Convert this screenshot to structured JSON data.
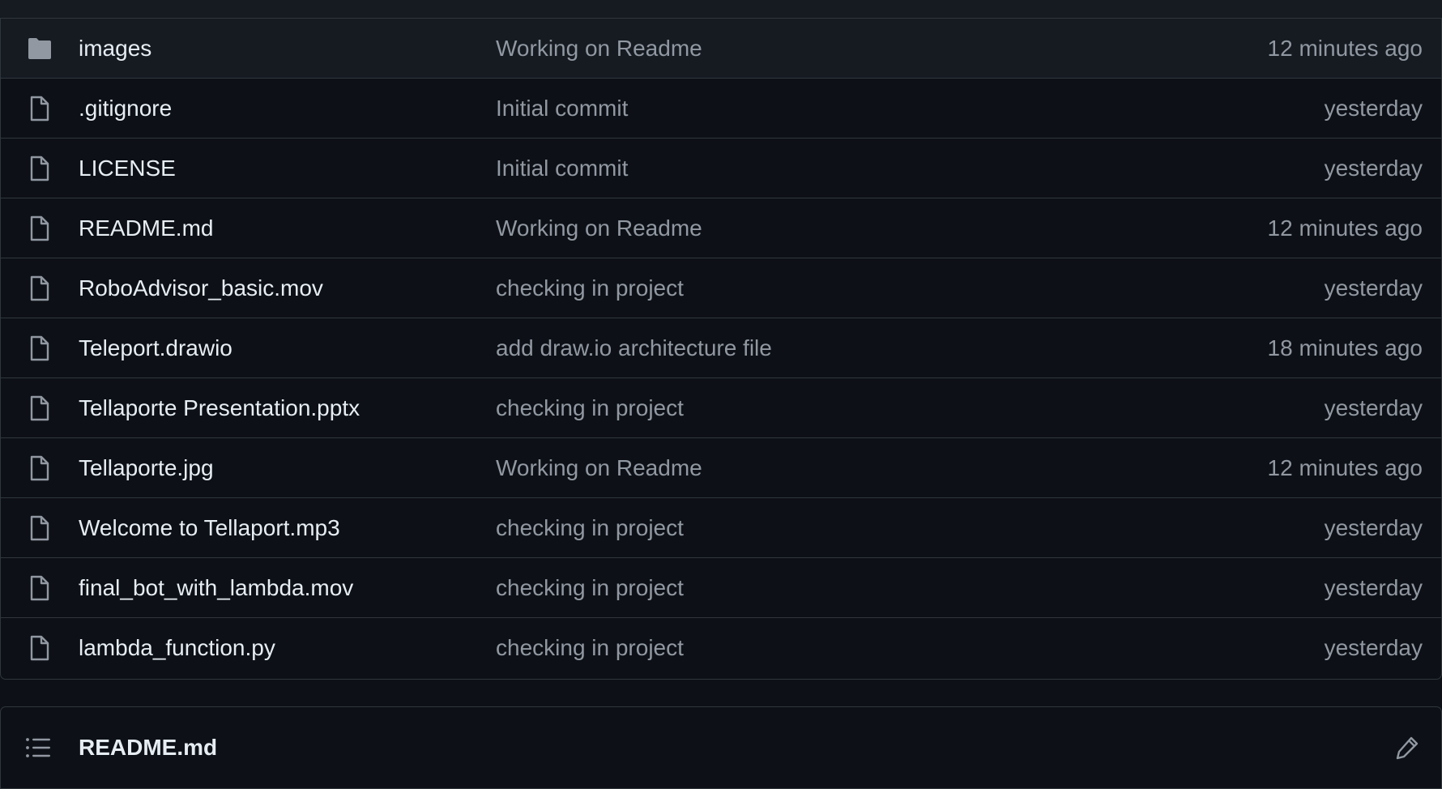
{
  "colors": {
    "background": "#0d1117",
    "row_highlight": "#161b22",
    "border": "#30363d",
    "text_primary": "#e6edf3",
    "text_muted": "#9198a1",
    "icon": "#9198a1"
  },
  "files": [
    {
      "icon": "folder-icon",
      "name": "images",
      "commit": "Working on Readme",
      "time": "12 minutes ago"
    },
    {
      "icon": "file-icon",
      "name": ".gitignore",
      "commit": "Initial commit",
      "time": "yesterday"
    },
    {
      "icon": "file-icon",
      "name": "LICENSE",
      "commit": "Initial commit",
      "time": "yesterday"
    },
    {
      "icon": "file-icon",
      "name": "README.md",
      "commit": "Working on Readme",
      "time": "12 minutes ago"
    },
    {
      "icon": "file-icon",
      "name": "RoboAdvisor_basic.mov",
      "commit": "checking in project",
      "time": "yesterday"
    },
    {
      "icon": "file-icon",
      "name": "Teleport.drawio",
      "commit": "add draw.io architecture file",
      "time": "18 minutes ago"
    },
    {
      "icon": "file-icon",
      "name": "Tellaporte Presentation.pptx",
      "commit": "checking in project",
      "time": "yesterday"
    },
    {
      "icon": "file-icon",
      "name": "Tellaporte.jpg",
      "commit": "Working on Readme",
      "time": "12 minutes ago"
    },
    {
      "icon": "file-icon",
      "name": "Welcome to Tellaport.mp3",
      "commit": "checking in project",
      "time": "yesterday"
    },
    {
      "icon": "file-icon",
      "name": "final_bot_with_lambda.mov",
      "commit": "checking in project",
      "time": "yesterday"
    },
    {
      "icon": "file-icon",
      "name": "lambda_function.py",
      "commit": "checking in project",
      "time": "yesterday"
    }
  ],
  "readme": {
    "title": "README.md",
    "toc_icon": "list-icon",
    "edit_icon": "pencil-icon"
  }
}
